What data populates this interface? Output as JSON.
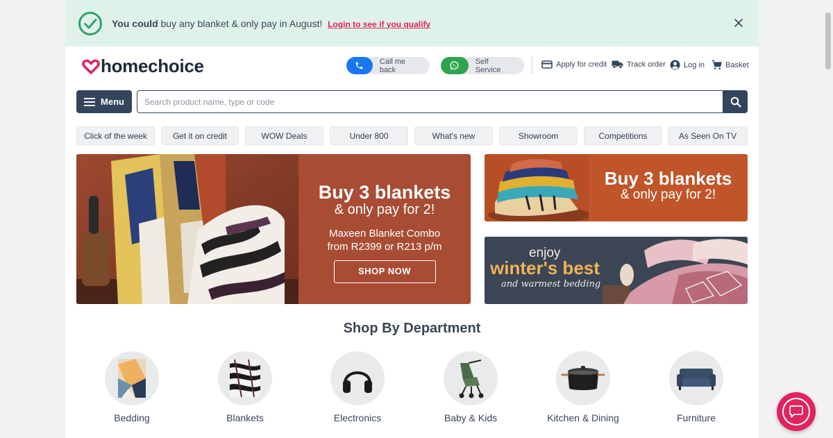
{
  "promo": {
    "bold": "You could",
    "text": "buy any blanket & only pay in August!",
    "link": "Login to see if you qualify"
  },
  "header": {
    "logo": "homechoice",
    "call_me_back": "Call me back",
    "self_service": "Self Service",
    "apply_credit": "Apply for credit",
    "track_order": "Track order",
    "log_in": "Log in",
    "basket": "Basket"
  },
  "search": {
    "menu_label": "Menu",
    "placeholder": "Search product name, type or code"
  },
  "categories": [
    "Click of the week",
    "Get it on credit",
    "WOW Deals",
    "Under 800",
    "What's new",
    "Showroom",
    "Competitions",
    "As Seen On TV"
  ],
  "hero": {
    "title": "Buy 3 blankets",
    "subtitle": "& only pay for 2!",
    "desc1": "Maxeen Blanket Combo",
    "desc2": "from R2399 or R213 p/m",
    "cta": "SHOP NOW"
  },
  "side_banner_1": {
    "title": "Buy 3 blankets",
    "subtitle": "& only pay for 2!"
  },
  "side_banner_2": {
    "enjoy": "enjoy",
    "headline": "winter's best",
    "tagline": "and warmest bedding"
  },
  "departments": {
    "title": "Shop By Department",
    "items": [
      "Bedding",
      "Blankets",
      "Electronics",
      "Baby & Kids",
      "Kitchen & Dining",
      "Furniture"
    ]
  },
  "colors": {
    "brand_pink": "#e0245e",
    "navy": "#33455c",
    "promo_bg": "#dff2ea",
    "hero_panel": "#a84c34"
  }
}
